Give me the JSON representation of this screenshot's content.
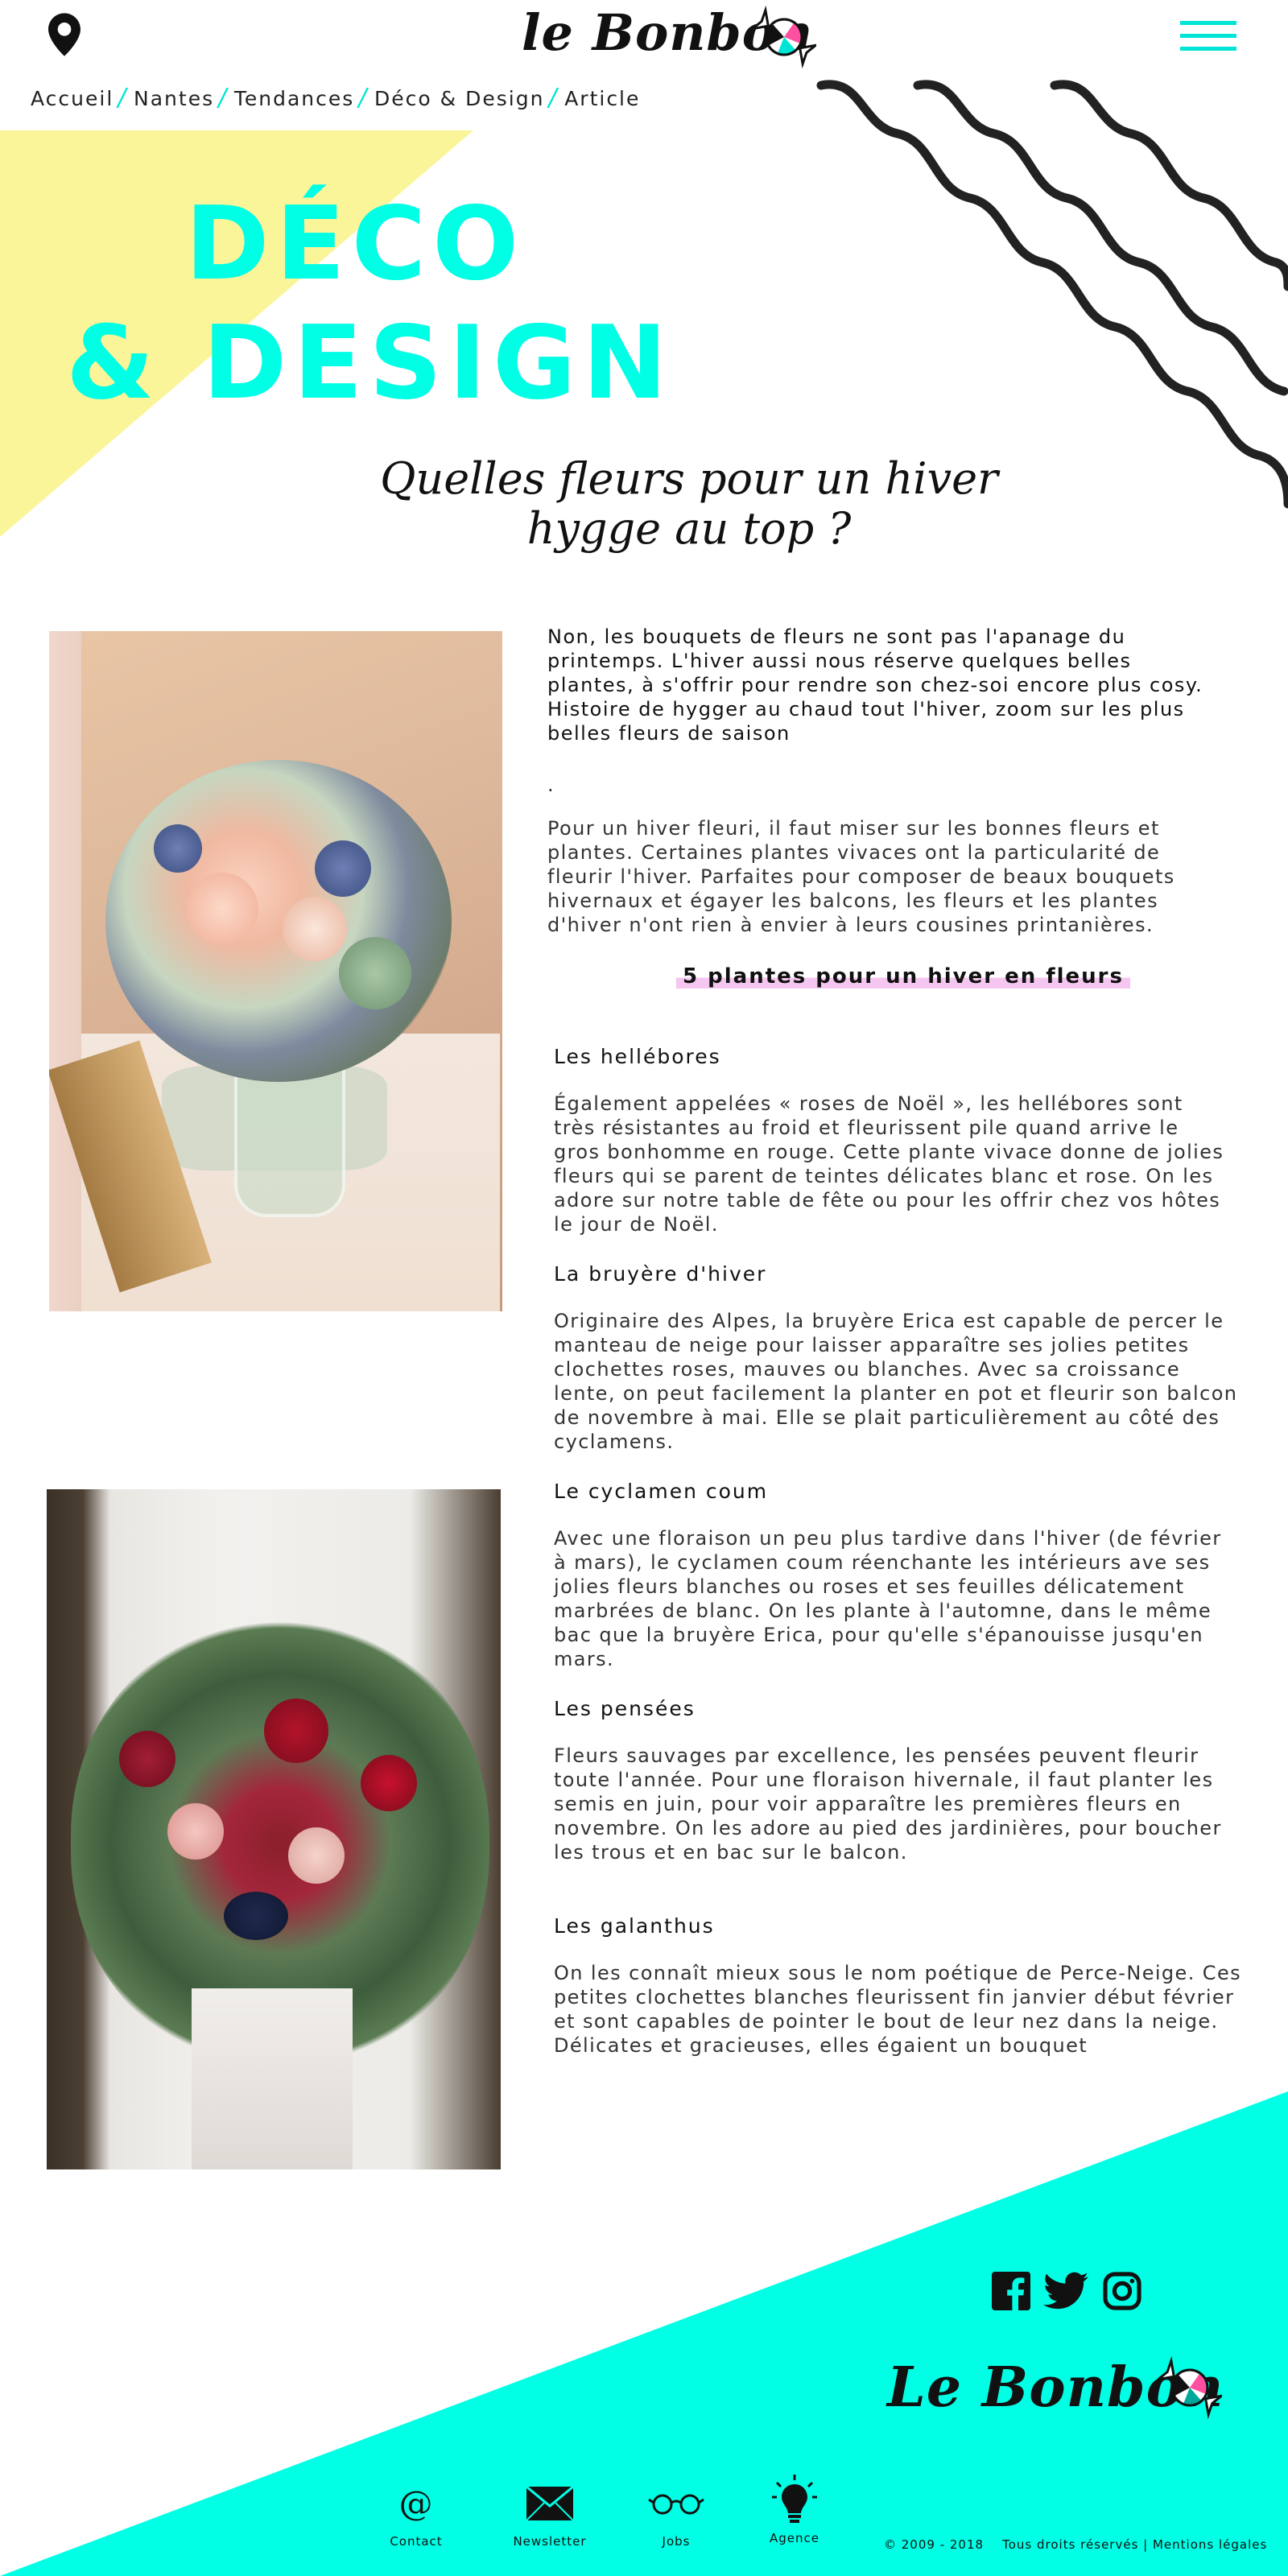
{
  "header": {
    "logo_text": "le Bonbon",
    "location_icon": "location-pin-icon",
    "menu_icon": "hamburger-menu-icon"
  },
  "breadcrumb": [
    "Accueil",
    "Nantes",
    "Tendances",
    "Déco & Design",
    "Article"
  ],
  "hero": {
    "line1": "DÉCO",
    "line2": "& DESIGN",
    "subtitle_line1": "Quelles fleurs pour un hiver",
    "subtitle_line2": "hygge au top ?"
  },
  "article": {
    "intro": "Non, les bouquets de fleurs ne sont pas l'apanage du printemps. L'hiver aussi nous réserve quelques belles plantes, à s'offrir pour rendre son chez-soi encore plus cosy. Histoire de hygger au chaud tout l'hiver, zoom sur les plus belles fleurs de saison",
    "dot": ".",
    "paragraph1": "Pour un hiver fleuri, il faut miser sur les bonnes fleurs et plantes. Certaines plantes vivaces ont la particularité de fleurir l'hiver. Parfaites pour composer de beaux bouquets hivernaux et égayer les balcons, les fleurs et les plantes d'hiver n'ont rien à envier à leurs cousines printanières.",
    "highlight": "5 plantes pour un hiver en fleurs",
    "sections": [
      {
        "title": "Les hellébores",
        "text": "Également appelées « roses de Noël », les hellébores sont très résistantes au froid et fleurissent pile quand arrive le gros bonhomme en rouge. Cette plante vivace donne de jolies fleurs qui se parent de teintes délicates blanc et rose. On les adore sur notre table de fête ou pour les offrir chez vos hôtes le jour de Noël."
      },
      {
        "title": "La bruyère d'hiver",
        "text": "Originaire des Alpes, la bruyère Erica est capable de percer le manteau de neige pour laisser apparaître ses jolies petites clochettes roses, mauves ou blanches. Avec sa croissance lente, on peut facilement la planter en pot et fleurir son balcon de novembre à mai. Elle se plait particulièrement au côté des cyclamens."
      },
      {
        "title": "Le cyclamen coum",
        "text": "Avec une floraison un peu plus tardive dans l'hiver (de février à mars), le cyclamen coum réenchante les intérieurs ave ses jolies fleurs blanches ou roses et ses feuilles délicatement marbrées de blanc. On les plante à l'automne, dans le même bac que la bruyère Erica, pour qu'elle s'épanouisse jusqu'en mars."
      },
      {
        "title": "Les pensées",
        "text": "Fleurs sauvages par excellence, les pensées peuvent fleurir toute l'année. Pour une floraison hivernale, il faut planter les semis en juin, pour voir apparaître les premières fleurs en novembre. On les adore au pied des jardinières, pour boucher les trous et en bac sur le balcon."
      },
      {
        "title": "Les galanthus",
        "text": "On les connaît mieux sous le nom poétique de Perce-Neige. Ces petites clochettes blanches fleurissent fin janvier début février et sont capables de pointer le bout de leur nez dans la neige. Délicates et gracieuses, elles égaient un bouquet"
      }
    ]
  },
  "footer": {
    "logo_text": "Le Bonbon",
    "social": [
      "facebook-icon",
      "twitter-icon",
      "instagram-icon"
    ],
    "links": [
      {
        "label": "Contact",
        "icon": "at-sign-icon"
      },
      {
        "label": "Newsletter",
        "icon": "envelope-icon"
      },
      {
        "label": "Jobs",
        "icon": "glasses-icon"
      },
      {
        "label": "Agence",
        "icon": "lightbulb-icon"
      }
    ],
    "legal": "© 2009 - 2018    Tous droits réservés | Mentions légales"
  },
  "colors": {
    "accent": "#00ffe5",
    "yellow": "#fbf59a",
    "highlight": "#f5c6ef"
  }
}
